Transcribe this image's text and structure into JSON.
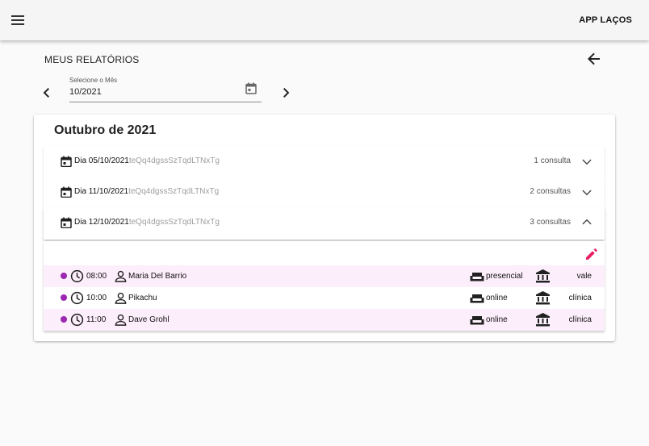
{
  "appbar": {
    "title": "APP LAÇOS",
    "menu_icon": "menu-icon"
  },
  "page": {
    "title": "MEUS RELATÓRIOS",
    "back_icon": "arrow-back-icon"
  },
  "month_picker": {
    "label": "Selecione o Mês",
    "value": "10/2021",
    "prev_icon": "chevron-left-icon",
    "next_icon": "chevron-right-icon",
    "calendar_icon": "calendar-icon"
  },
  "report": {
    "title": "Outubro de 2021",
    "days": [
      {
        "day": "Dia 05/10/2021",
        "id": "teQq4dgssSzTqdLTNxTg",
        "count": "1 consulta",
        "expanded": false
      },
      {
        "day": "Dia 11/10/2021",
        "id": "teQq4dgssSzTqdLTNxTg",
        "count": "2 consultas",
        "expanded": false
      },
      {
        "day": "Dia 12/10/2021",
        "id": "teQq4dgssSzTqdLTNxTg",
        "count": "3 consultas",
        "expanded": true
      }
    ],
    "appointments": [
      {
        "time": "08:00",
        "patient": "Maria Del Barrio",
        "mode": "presencial",
        "place": "vale"
      },
      {
        "time": "10:00",
        "patient": "Pikachu",
        "mode": "online",
        "place": "clínica"
      },
      {
        "time": "11:00",
        "patient": "Dave Grohl",
        "mode": "online",
        "place": "clínica"
      }
    ]
  },
  "colors": {
    "accent": "#e91e63",
    "status_dot": "#9c27b0",
    "row_highlight": "#fdeefb",
    "appbar": "#f5f5f5"
  }
}
